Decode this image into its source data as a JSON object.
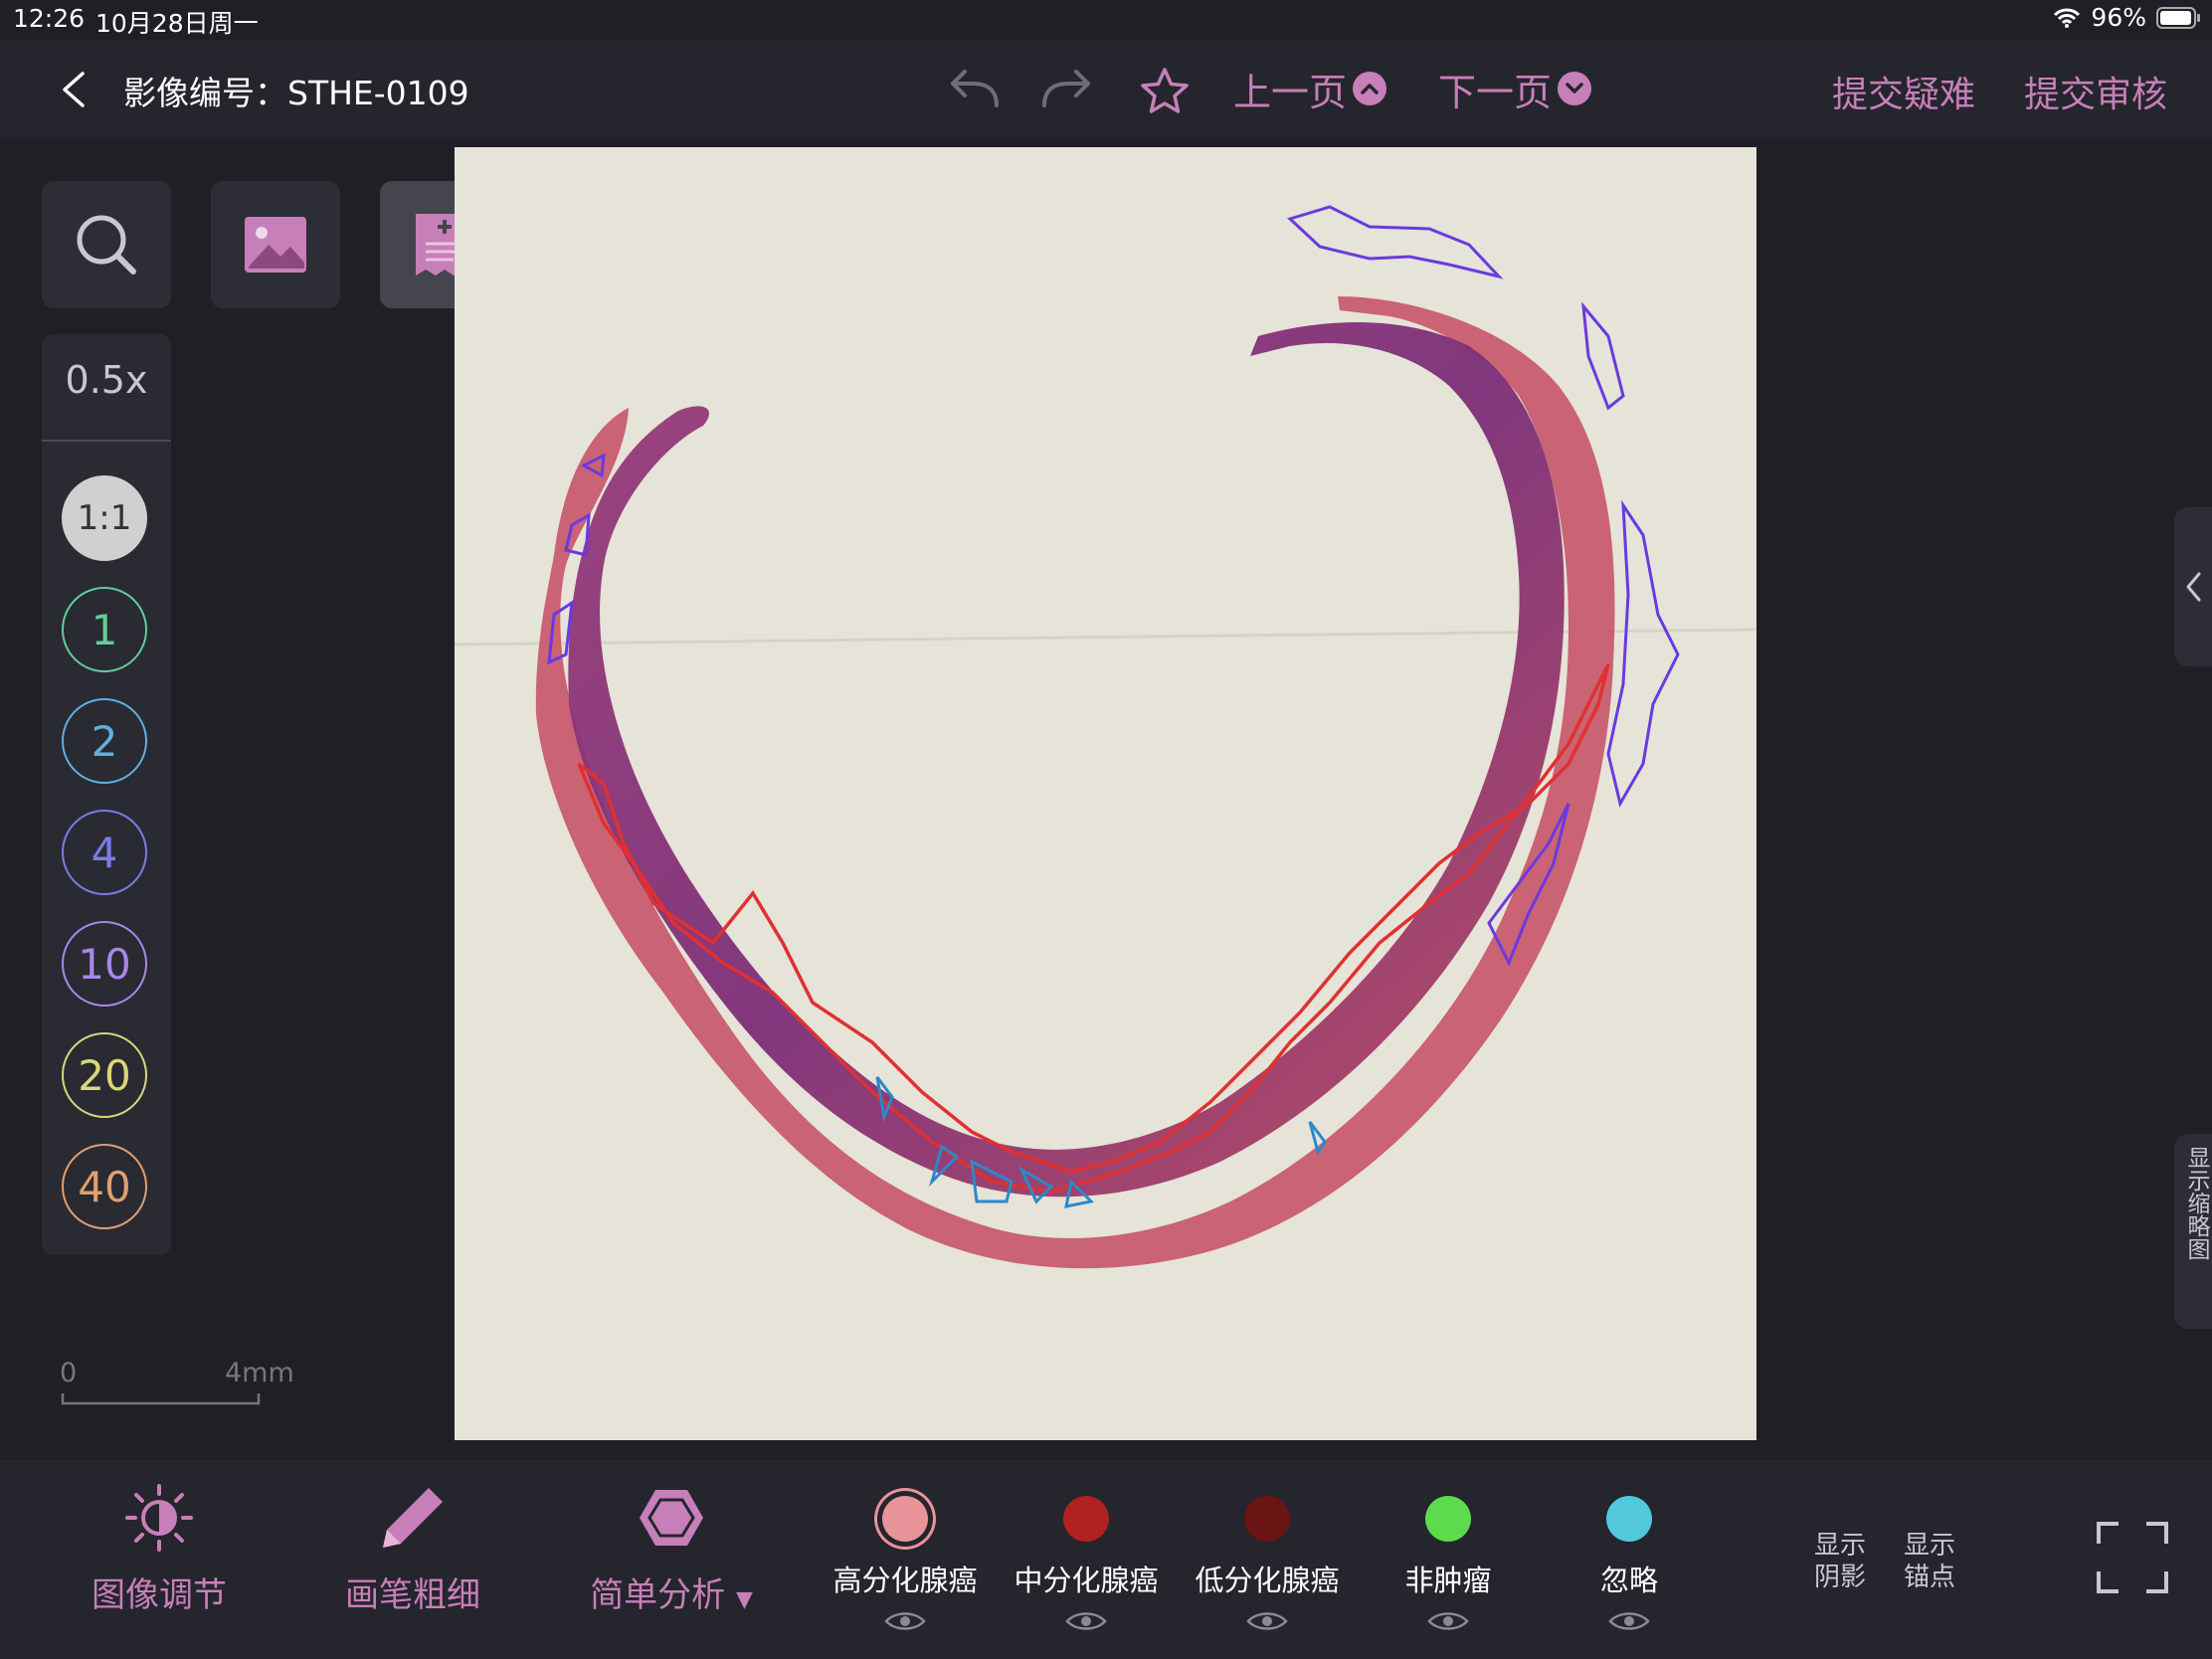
{
  "status_bar": {
    "time": "12:26",
    "date": "10月28日周一",
    "battery": "96%"
  },
  "header": {
    "image_id_label": "影像编号：STHE-0109",
    "prev_page": "上一页",
    "next_page": "下一页",
    "submit_question": "提交疑难",
    "submit_review": "提交审核"
  },
  "zoom": {
    "current": "0.5x",
    "levels": [
      {
        "label": "1:1",
        "color": "#d0d0d0"
      },
      {
        "label": "1",
        "color": "#5fcf9a"
      },
      {
        "label": "2",
        "color": "#5fb0e0"
      },
      {
        "label": "4",
        "color": "#7b7be8"
      },
      {
        "label": "10",
        "color": "#a888e8"
      },
      {
        "label": "20",
        "color": "#d8d87a"
      },
      {
        "label": "40",
        "color": "#e0a070"
      }
    ]
  },
  "scale_bar": {
    "start": "0",
    "end": "4mm"
  },
  "thumbnail_toggle": "显示缩略图",
  "bottom_tools": {
    "image_adjust": "图像调节",
    "brush_width": "画笔粗细",
    "simple_analysis": "简单分析"
  },
  "label_categories": [
    {
      "name": "高分化腺癌",
      "color": "#e8949a",
      "selected": true
    },
    {
      "name": "中分化腺癌",
      "color": "#b02222",
      "selected": false
    },
    {
      "name": "低分化腺癌",
      "color": "#6a1414",
      "selected": false
    },
    {
      "name": "非肿瘤",
      "color": "#5cdc4c",
      "selected": false
    },
    {
      "name": "忽略",
      "color": "#52c8dc",
      "selected": false
    }
  ],
  "toggles": {
    "show_shadow": "显示阴影",
    "show_anchor": "显示锚点"
  },
  "colors": {
    "accent": "#c77fb9",
    "background": "#1f1f26",
    "panel": "#2d2d36"
  }
}
